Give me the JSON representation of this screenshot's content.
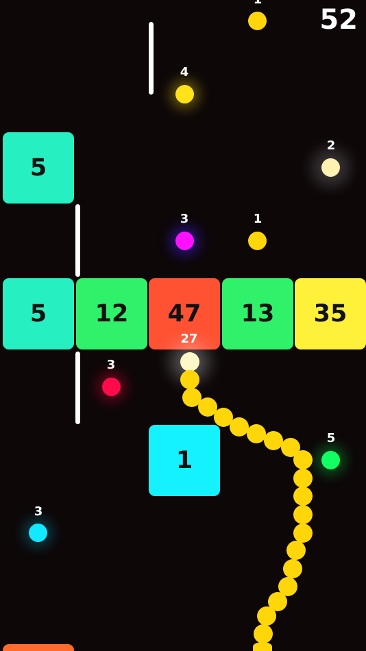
{
  "score": "52",
  "snake": {
    "length_label": "27",
    "color": "#ffd60a"
  },
  "blocks": {
    "upper_left": {
      "value": "5",
      "color": "#26f0c1"
    },
    "row": [
      {
        "value": "5",
        "color": "#26f0c1"
      },
      {
        "value": "12",
        "color": "#2ff26a"
      },
      {
        "value": "47",
        "color": "#ff5233"
      },
      {
        "value": "13",
        "color": "#2ff26a"
      },
      {
        "value": "35",
        "color": "#fff03a"
      }
    ],
    "lower_center": {
      "value": "1",
      "color": "#14f1ff"
    }
  },
  "orbs": [
    {
      "name": "top-edge",
      "label": "1",
      "color": "#ffd60a"
    },
    {
      "name": "upper-yellow",
      "label": "4",
      "color": "#ffe21a"
    },
    {
      "name": "upper-white",
      "label": "2",
      "color": "#fff1b2"
    },
    {
      "name": "magenta",
      "label": "3",
      "color": "#ff10ff"
    },
    {
      "name": "small-yellow",
      "label": "1",
      "color": "#ffd60a"
    },
    {
      "name": "red",
      "label": "3",
      "color": "#ff0a4a"
    },
    {
      "name": "green",
      "label": "5",
      "color": "#10ff62"
    },
    {
      "name": "cyan",
      "label": "3",
      "color": "#12e8ff"
    }
  ]
}
